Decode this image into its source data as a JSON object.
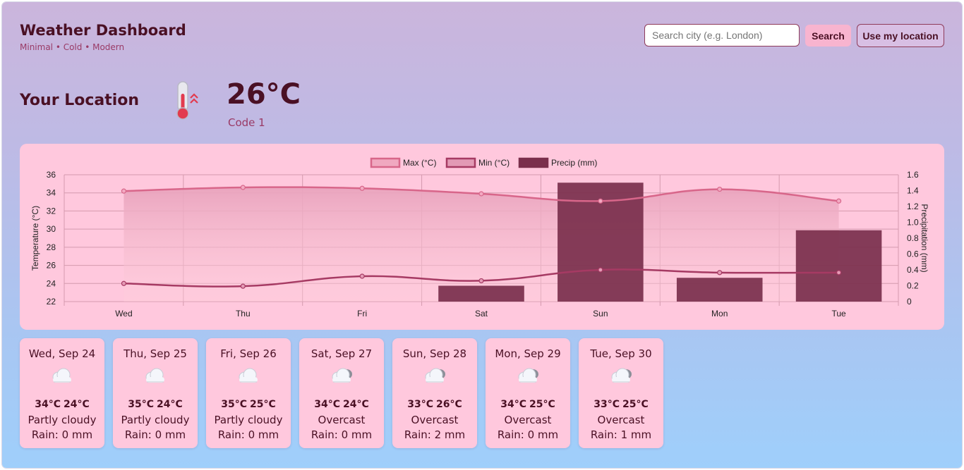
{
  "header": {
    "title": "Weather Dashboard",
    "subtitle": "Minimal • Cold • Modern"
  },
  "search": {
    "placeholder": "Search city (e.g. London)",
    "value": "",
    "search_label": "Search",
    "location_label": "Use my location"
  },
  "current": {
    "location": "Your Location",
    "temp": "26°C",
    "code": "Code 1",
    "icon": "thermometer-hot-icon"
  },
  "colors": {
    "max_line": "#d8668a",
    "min_line": "#a63a63",
    "precip_bar": "#7a2f4c",
    "card": "#ffc8dd"
  },
  "chart_data": {
    "type": "bar+line",
    "categories": [
      "Wed",
      "Thu",
      "Fri",
      "Sat",
      "Sun",
      "Mon",
      "Tue"
    ],
    "series": [
      {
        "name": "Max (°C)",
        "type": "line",
        "axis": "left",
        "values": [
          34.2,
          34.6,
          34.5,
          33.9,
          33.1,
          34.4,
          33.1
        ]
      },
      {
        "name": "Min (°C)",
        "type": "line",
        "axis": "left",
        "values": [
          24.0,
          23.7,
          24.8,
          24.3,
          25.5,
          25.2,
          25.2
        ]
      },
      {
        "name": "Precip (mm)",
        "type": "bar",
        "axis": "right",
        "values": [
          0,
          0,
          0,
          0.2,
          1.5,
          0.3,
          0.9
        ]
      }
    ],
    "ylabel": "Temperature (°C)",
    "y2label": "Precipitation (mm)",
    "ylim": [
      22,
      36
    ],
    "y2lim": [
      0,
      1.6
    ],
    "yticks": [
      "22",
      "24",
      "26",
      "28",
      "30",
      "32",
      "34",
      "36"
    ],
    "y2ticks": [
      "0",
      "0.2",
      "0.4",
      "0.6",
      "0.8",
      "1.0",
      "1.2",
      "1.4",
      "1.6"
    ],
    "legend_position": "top",
    "grid": true
  },
  "days": [
    {
      "date": "Wed, Sep 24",
      "max": "34°C",
      "min": "24°C",
      "condition": "Partly cloudy",
      "rain": "Rain: 0 mm",
      "icon": "cloud-icon"
    },
    {
      "date": "Thu, Sep 25",
      "max": "35°C",
      "min": "24°C",
      "condition": "Partly cloudy",
      "rain": "Rain: 0 mm",
      "icon": "cloud-icon"
    },
    {
      "date": "Fri, Sep 26",
      "max": "35°C",
      "min": "25°C",
      "condition": "Partly cloudy",
      "rain": "Rain: 0 mm",
      "icon": "cloud-icon"
    },
    {
      "date": "Sat, Sep 27",
      "max": "34°C",
      "min": "24°C",
      "condition": "Overcast",
      "rain": "Rain: 0 mm",
      "icon": "overcast-cloud-icon"
    },
    {
      "date": "Sun, Sep 28",
      "max": "33°C",
      "min": "26°C",
      "condition": "Overcast",
      "rain": "Rain: 2 mm",
      "icon": "overcast-cloud-icon"
    },
    {
      "date": "Mon, Sep 29",
      "max": "34°C",
      "min": "25°C",
      "condition": "Overcast",
      "rain": "Rain: 0 mm",
      "icon": "overcast-cloud-icon"
    },
    {
      "date": "Tue, Sep 30",
      "max": "33°C",
      "min": "25°C",
      "condition": "Overcast",
      "rain": "Rain: 1 mm",
      "icon": "overcast-cloud-icon"
    }
  ]
}
